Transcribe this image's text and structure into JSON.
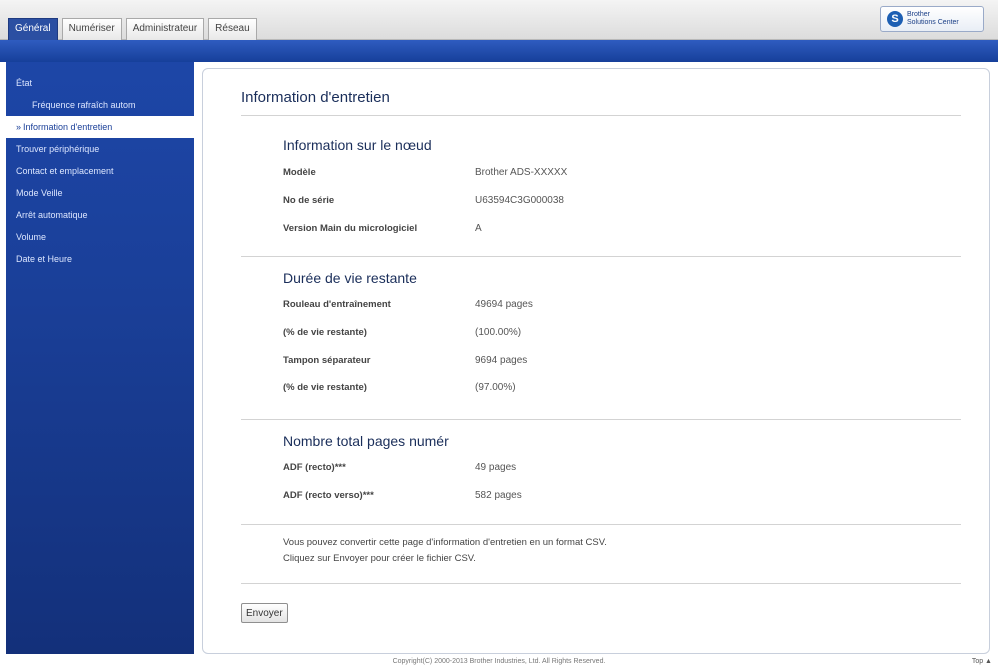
{
  "tabs": [
    {
      "label": "Général",
      "active": true
    },
    {
      "label": "Numériser",
      "active": false
    },
    {
      "label": "Administrateur",
      "active": false
    },
    {
      "label": "Réseau",
      "active": false
    }
  ],
  "brand": {
    "line1": "Brother",
    "line2": "Solutions Center",
    "icon": "brother-solutions-logo"
  },
  "sidebar": {
    "items": [
      {
        "label": "État"
      },
      {
        "label": "Fréquence rafraîch autom"
      },
      {
        "label": "Information d'entretien"
      },
      {
        "label": "Trouver périphérique"
      },
      {
        "label": "Contact et emplacement"
      },
      {
        "label": "Mode Veille"
      },
      {
        "label": "Arrêt automatique"
      },
      {
        "label": "Volume"
      },
      {
        "label": "Date et Heure"
      }
    ]
  },
  "main": {
    "title": "Information d'entretien",
    "node": {
      "title": "Information sur le nœud",
      "rows": [
        {
          "label": "Modèle",
          "value": "Brother ADS-XXXXX"
        },
        {
          "label": "No de série",
          "value": "U63594C3G000038"
        },
        {
          "label": "Version Main du micrologiciel",
          "value": "A"
        }
      ]
    },
    "life": {
      "title": "Durée de vie restante",
      "rows": [
        {
          "label": "Rouleau d'entraînement",
          "value": "49694 pages"
        },
        {
          "label": "(% de vie restante)",
          "value": "(100.00%)"
        },
        {
          "label": "Tampon séparateur",
          "value": "9694 pages"
        },
        {
          "label": "(% de vie restante)",
          "value": "(97.00%)"
        }
      ]
    },
    "totals": {
      "title": "Nombre total pages numér",
      "rows": [
        {
          "label": "ADF (recto)***",
          "value": "49 pages"
        },
        {
          "label": "ADF (recto verso)***",
          "value": "582 pages"
        }
      ]
    },
    "note": {
      "line1": "Vous pouvez convertir cette page d'information d'entretien en un format CSV.",
      "line2": "Cliquez sur Envoyer pour créer le fichier CSV."
    },
    "send_button": "Envoyer"
  },
  "footer": {
    "copyright": "Copyright(C) 2000-2013 Brother Industries, Ltd. All Rights Reserved.",
    "top_link": "Top ▲"
  }
}
